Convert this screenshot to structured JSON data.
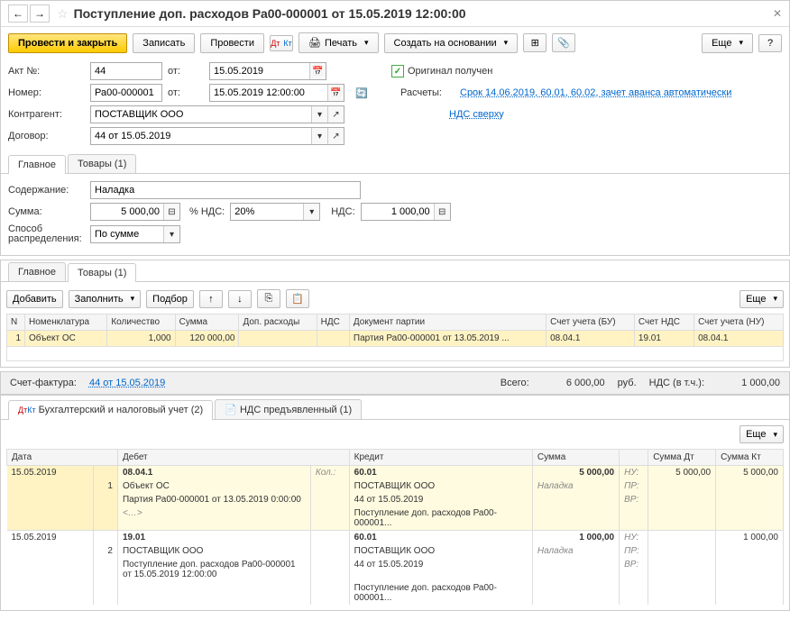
{
  "header": {
    "title": "Поступление доп. расходов Ра00-000001 от 15.05.2019 12:00:00"
  },
  "toolbar": {
    "post_close": "Провести и закрыть",
    "write": "Записать",
    "post": "Провести",
    "print": "Печать",
    "create_based": "Создать на основании",
    "more": "Еще"
  },
  "form": {
    "akt_no_label": "Акт №:",
    "akt_no": "44",
    "from_label": "от:",
    "akt_date": "15.05.2019",
    "original_received": "Оригинал получен",
    "number_label": "Номер:",
    "number": "Ра00-000001",
    "number_date": "15.05.2019 12:00:00",
    "settlements_label": "Расчеты:",
    "settlements_link": "Срок 14.06.2019, 60.01, 60.02, зачет аванса автоматически",
    "counterparty_label": "Контрагент:",
    "counterparty": "ПОСТАВЩИК ООО",
    "vat_link": "НДС сверху",
    "contract_label": "Договор:",
    "contract": "44 от 15.05.2019"
  },
  "tabs_upper": {
    "main": "Главное",
    "goods": "Товары (1)"
  },
  "main_tab": {
    "content_label": "Содержание:",
    "content": "Наладка",
    "sum_label": "Сумма:",
    "sum": "5 000,00",
    "vat_pct_label": "% НДС:",
    "vat_pct": "20%",
    "vat_label": "НДС:",
    "vat": "1 000,00",
    "distrib_label": "Способ распределения:",
    "distrib": "По сумме"
  },
  "goods_toolbar": {
    "add": "Добавить",
    "fill": "Заполнить",
    "select": "Подбор",
    "more": "Еще"
  },
  "goods_headers": {
    "n": "N",
    "nom": "Номенклатура",
    "qty": "Количество",
    "sum": "Сумма",
    "addexp": "Доп. расходы",
    "vat": "НДС",
    "doc": "Документ партии",
    "acc_bu": "Счет учета (БУ)",
    "acc_vat": "Счет НДС",
    "acc_nu": "Счет учета (НУ)"
  },
  "goods_row": {
    "n": "1",
    "nom": "Объект ОС",
    "qty": "1,000",
    "sum": "120 000,00",
    "doc": "Партия Ра00-000001 от 13.05.2019 ...",
    "acc_bu": "08.04.1",
    "acc_vat": "19.01",
    "acc_nu": "08.04.1"
  },
  "invoice": {
    "label": "Счет-фактура:",
    "link": "44 от 15.05.2019"
  },
  "totals": {
    "total_label": "Всего:",
    "total": "6 000,00",
    "currency": "руб.",
    "vat_label": "НДС (в т.ч.):",
    "vat": "1 000,00"
  },
  "subtabs": {
    "acc": "Бухгалтерский и налоговый учет (2)",
    "vat": "НДС предъявленный (1)"
  },
  "acc_headers": {
    "date": "Дата",
    "debit": "Дебет",
    "credit": "Кредит",
    "sum": "Сумма",
    "sum_dt": "Сумма Дт",
    "sum_kt": "Сумма Кт"
  },
  "acc": {
    "r1": {
      "date": "15.05.2019",
      "debit": "08.04.1",
      "kol": "Кол.:",
      "credit": "60.01",
      "sum": "5 000,00",
      "nu": "НУ:",
      "sum_dt": "5 000,00",
      "sum_kt": "5 000,00"
    },
    "r1a": {
      "n": "1",
      "debit": "Объект ОС",
      "credit": "ПОСТАВЩИК ООО",
      "sum": "Наладка",
      "pr": "ПР:"
    },
    "r1b": {
      "debit": "Партия Ра00-000001 от 13.05.2019 0:00:00",
      "credit": "44 от 15.05.2019",
      "vr": "ВР:"
    },
    "r1c": {
      "debit": "<…>",
      "credit": "Поступление доп. расходов Ра00-000001..."
    },
    "r2": {
      "date": "15.05.2019",
      "debit": "19.01",
      "credit": "60.01",
      "sum": "1 000,00",
      "nu": "НУ:",
      "sum_kt": "1 000,00"
    },
    "r2a": {
      "n": "2",
      "debit": "ПОСТАВЩИК ООО",
      "credit": "ПОСТАВЩИК ООО",
      "sum": "Наладка",
      "pr": "ПР:"
    },
    "r2b": {
      "debit": "Поступление доп. расходов Ра00-000001 от 15.05.2019 12:00:00",
      "credit": "44 от 15.05.2019",
      "vr": "ВР:"
    },
    "r2c": {
      "credit": "Поступление доп. расходов Ра00-000001..."
    }
  }
}
